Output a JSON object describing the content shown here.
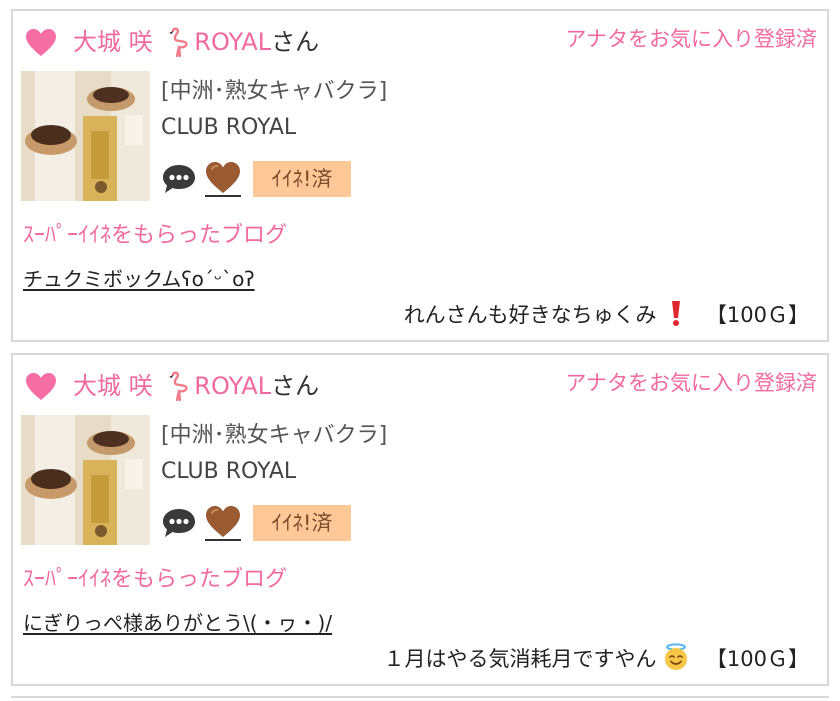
{
  "colors": {
    "accent_pink": "#f06aa0",
    "badge_bg": "#ffc896",
    "like_heart": "#9a5a32",
    "border": "#d8d8d8"
  },
  "posts": [
    {
      "cast_name": "大城 咲",
      "cast_tag": "ROYAL",
      "name_suffix": "さん",
      "favorite_status": "アナタをお気に入り登録済",
      "shop_area": "[中洲･熟女キャバクラ]",
      "shop_name": "CLUB ROYAL",
      "iine_label": "ｲｲﾈ!済",
      "blog_heading": "ｽｰﾊﾟｰｲｲﾈをもらったブログ",
      "blog_title": "チュクミボックムʕo´ᵕ`oʔ",
      "comment": "れんさんも好きなちゅくみ",
      "comment_emoji": "exclamation-icon",
      "points": "【100Ｇ】",
      "icons": [
        "heart-icon",
        "flamingo-icon",
        "chat-icon",
        "brown-heart-icon"
      ]
    },
    {
      "cast_name": "大城 咲",
      "cast_tag": "ROYAL",
      "name_suffix": "さん",
      "favorite_status": "アナタをお気に入り登録済",
      "shop_area": "[中洲･熟女キャバクラ]",
      "shop_name": "CLUB ROYAL",
      "iine_label": "ｲｲﾈ!済",
      "blog_heading": "ｽｰﾊﾟｰｲｲﾈをもらったブログ",
      "blog_title": "にぎりっぺ様ありがとう\\(・ヮ・)/",
      "comment": "１月はやる気消耗月ですやん",
      "comment_emoji": "angel-face-icon",
      "points": "【100Ｇ】",
      "icons": [
        "heart-icon",
        "flamingo-icon",
        "chat-icon",
        "brown-heart-icon"
      ]
    }
  ]
}
